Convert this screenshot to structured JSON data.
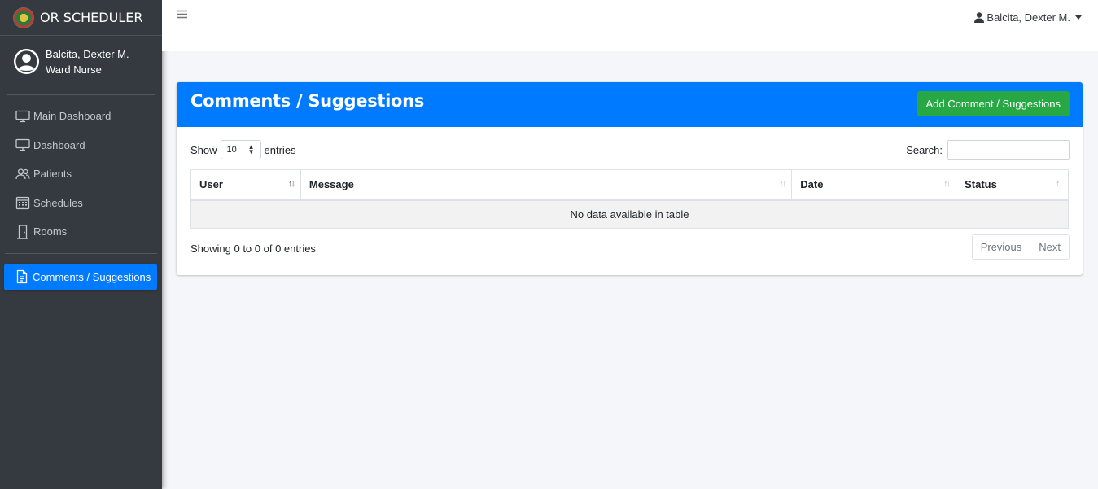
{
  "brand": {
    "title": "OR SCHEDULER"
  },
  "user": {
    "name": "Balcita, Dexter M.",
    "role": "Ward Nurse"
  },
  "sidebar": {
    "items": [
      {
        "label": "Main Dashboard",
        "icon": "desktop-icon"
      },
      {
        "label": "Dashboard",
        "icon": "desktop-icon"
      },
      {
        "label": "Patients",
        "icon": "users-icon"
      },
      {
        "label": "Schedules",
        "icon": "calendar-icon"
      },
      {
        "label": "Rooms",
        "icon": "door-icon"
      }
    ],
    "active_item": {
      "label": "Comments / Suggestions",
      "icon": "file-text-icon"
    }
  },
  "topbar": {
    "user_menu": "Balcita, Dexter M."
  },
  "card": {
    "title": "Comments / Suggestions",
    "add_button": "Add Comment / Suggestions"
  },
  "table_controls": {
    "show_label": "Show",
    "entries_value": "10",
    "entries_label": "entries",
    "search_label": "Search:"
  },
  "table": {
    "columns": [
      "User",
      "Message",
      "Date",
      "Status"
    ],
    "empty_message": "No data available in table"
  },
  "footer": {
    "info": "Showing 0 to 0 of 0 entries",
    "previous": "Previous",
    "next": "Next"
  },
  "colors": {
    "sidebar_bg": "#343a40",
    "primary": "#007bff",
    "success": "#28a745"
  }
}
